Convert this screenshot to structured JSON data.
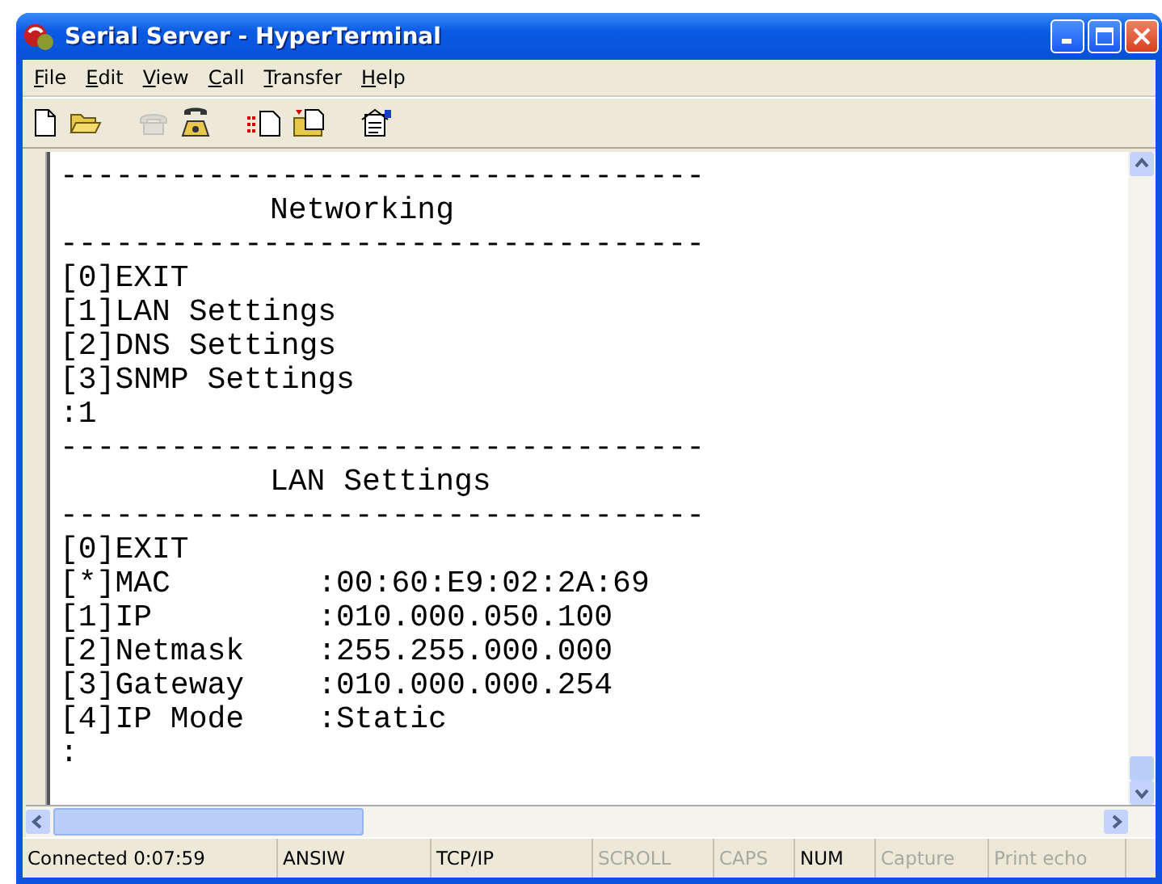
{
  "window": {
    "title": "Serial Server - HyperTerminal"
  },
  "menu": [
    {
      "label": "File"
    },
    {
      "label": "Edit"
    },
    {
      "label": "View"
    },
    {
      "label": "Call"
    },
    {
      "label": "Transfer"
    },
    {
      "label": "Help"
    }
  ],
  "toolbar": [
    {
      "kind": "new",
      "disabled": false
    },
    {
      "kind": "open",
      "disabled": false
    },
    {
      "kind": "disconnect",
      "disabled": true
    },
    {
      "kind": "dial",
      "disabled": false
    },
    {
      "kind": "send",
      "disabled": false
    },
    {
      "kind": "receive",
      "disabled": false
    },
    {
      "kind": "properties",
      "disabled": false
    }
  ],
  "terminal": {
    "lines": [
      {
        "kind": "rule",
        "text": "-----------------------------------"
      },
      {
        "kind": "heading",
        "text": "Networking"
      },
      {
        "kind": "rule",
        "text": "-----------------------------------"
      },
      {
        "kind": "line",
        "text": "[0]EXIT"
      },
      {
        "kind": "line",
        "text": "[1]LAN Settings"
      },
      {
        "kind": "line",
        "text": "[2]DNS Settings"
      },
      {
        "kind": "line",
        "text": "[3]SNMP Settings"
      },
      {
        "kind": "line",
        "text": ":1"
      },
      {
        "kind": "rule",
        "text": "-----------------------------------"
      },
      {
        "kind": "heading",
        "text": "LAN Settings"
      },
      {
        "kind": "rule",
        "text": "-----------------------------------"
      },
      {
        "kind": "line",
        "text": "[0]EXIT"
      },
      {
        "kind": "field",
        "label": "[*]MAC",
        "value": ":00:60:E9:02:2A:69"
      },
      {
        "kind": "field",
        "label": "[1]IP",
        "value": ":010.000.050.100"
      },
      {
        "kind": "field",
        "label": "[2]Netmask",
        "value": ":255.255.000.000"
      },
      {
        "kind": "field",
        "label": "[3]Gateway",
        "value": ":010.000.000.254"
      },
      {
        "kind": "field",
        "label": "[4]IP Mode",
        "value": ":Static"
      },
      {
        "kind": "line",
        "text": ":"
      }
    ]
  },
  "status_bar": [
    {
      "text": "Connected 0:07:59",
      "active": true
    },
    {
      "text": "ANSIW",
      "active": true
    },
    {
      "text": "TCP/IP",
      "active": true
    },
    {
      "text": "SCROLL",
      "active": false
    },
    {
      "text": "CAPS",
      "active": false
    },
    {
      "text": "NUM",
      "active": true
    },
    {
      "text": "Capture",
      "active": false
    },
    {
      "text": "Print echo",
      "active": false
    }
  ]
}
